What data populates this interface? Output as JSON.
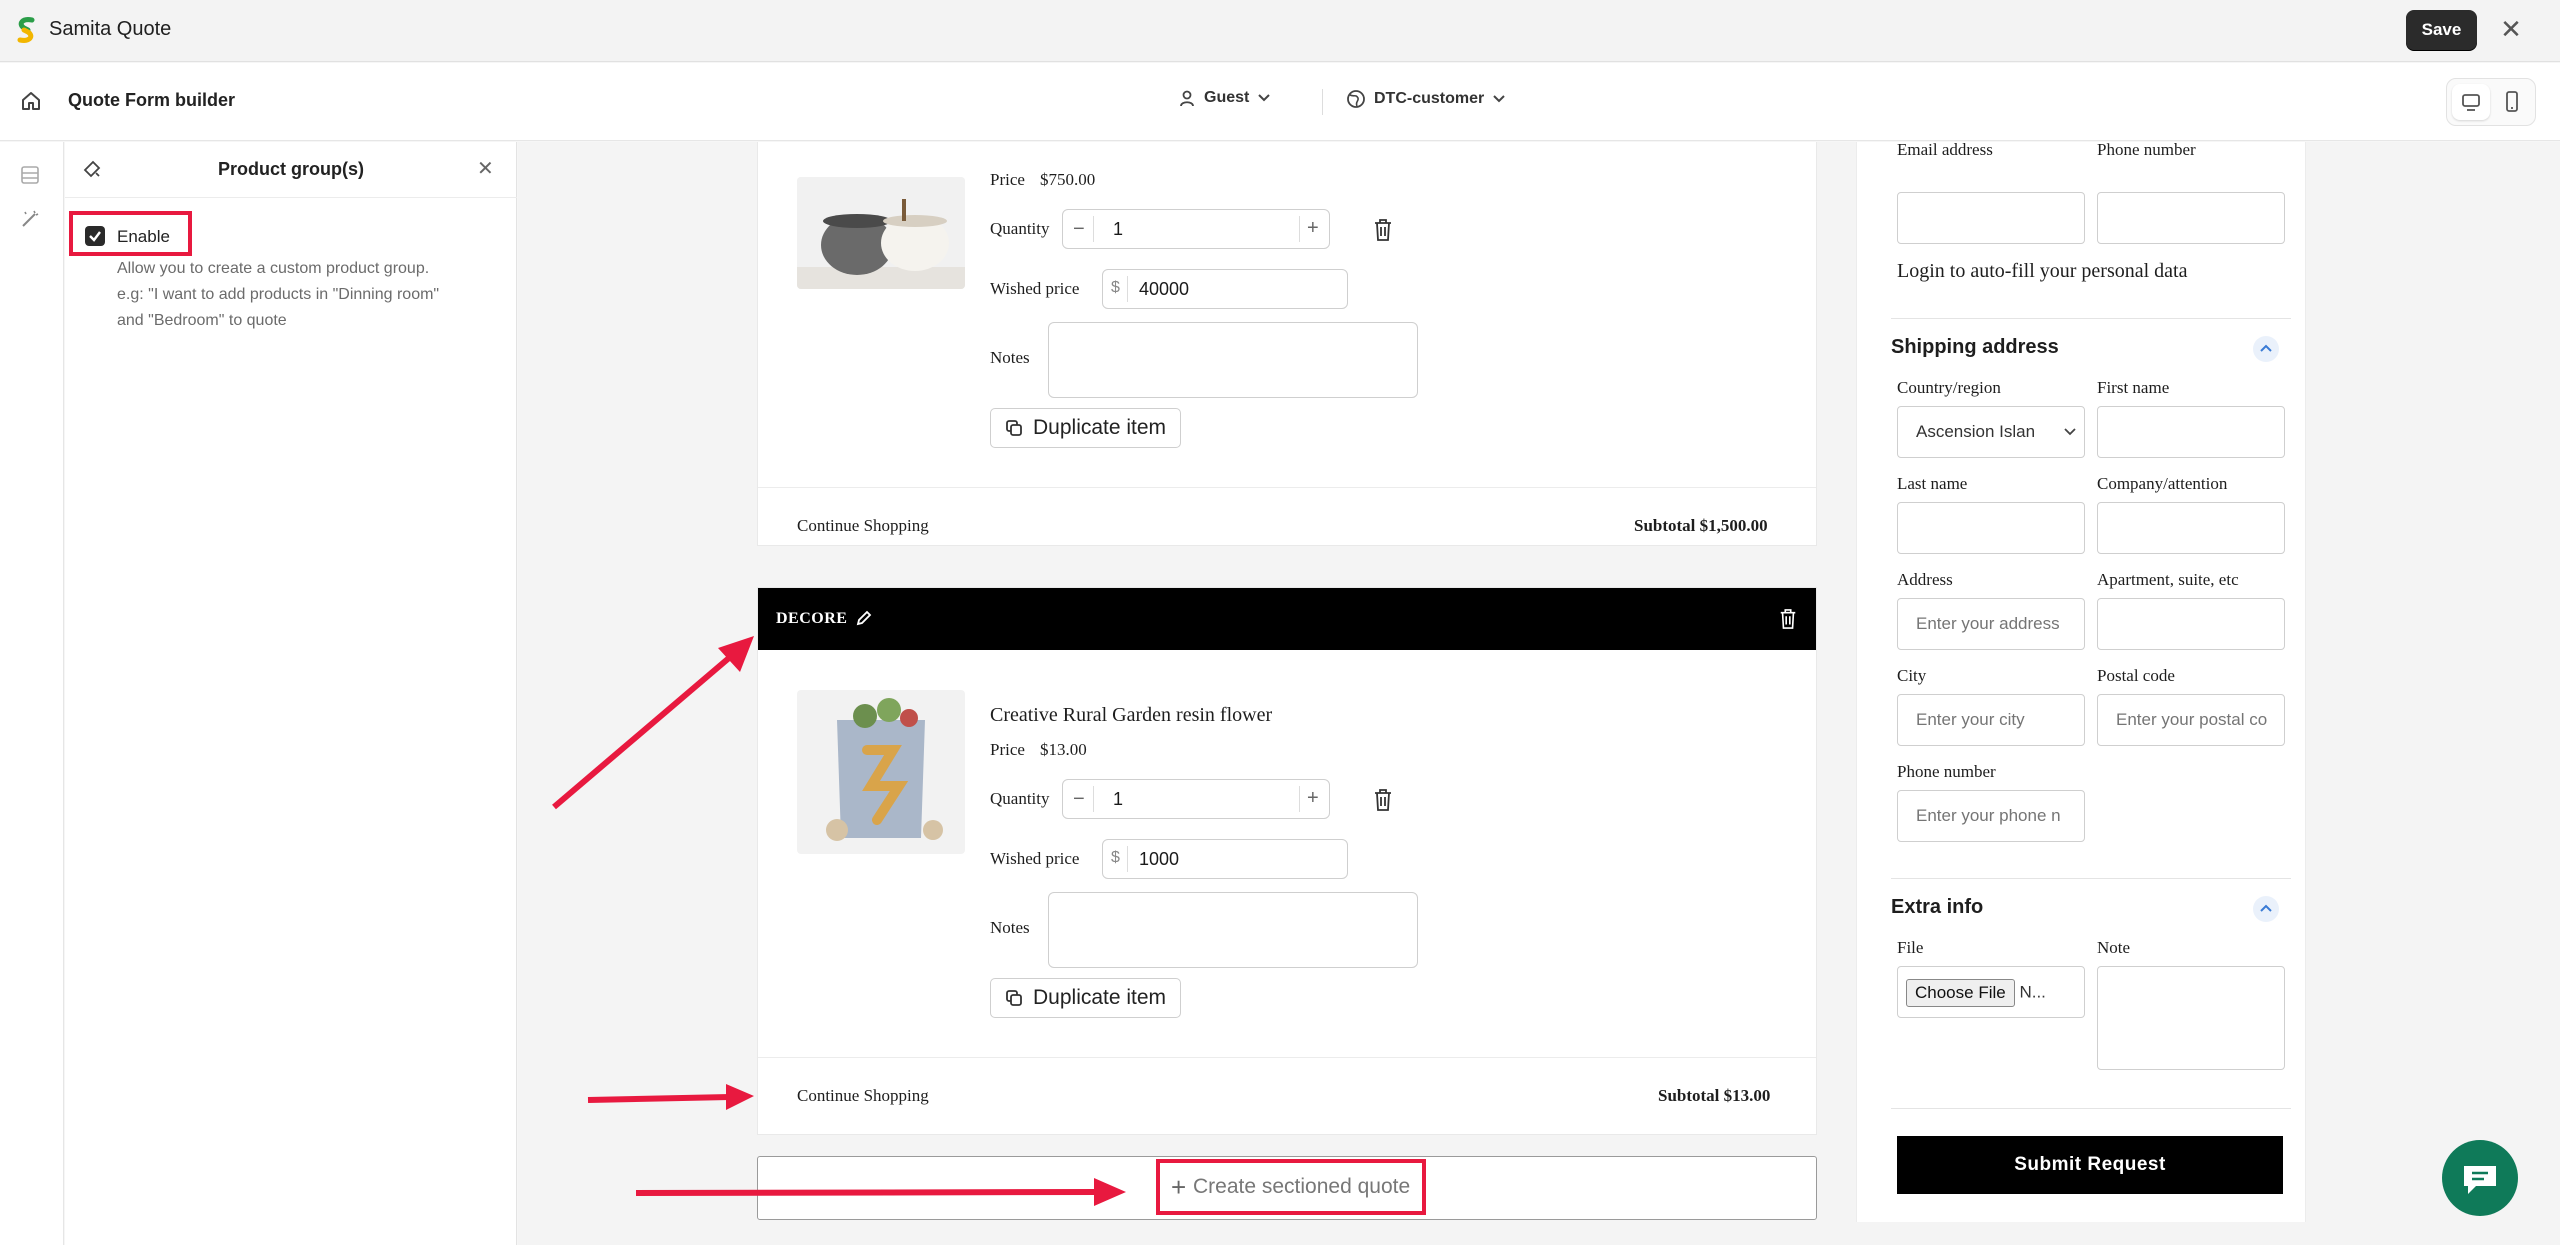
{
  "app": {
    "title": "Samita Quote",
    "save_label": "Save",
    "close_glyph": "✕"
  },
  "header": {
    "home_icon": "home-icon",
    "title": "Quote Form builder",
    "customer_type": "Guest",
    "customer_group": "DTC-customer"
  },
  "panel": {
    "title": "Product group(s)",
    "enable_label": "Enable",
    "enable_checked": true,
    "help_lines": [
      "Allow you to create a custom product group.",
      "e.g: \"I want to add products in \"Dinning room\"",
      "and \"Bedroom\" to quote"
    ]
  },
  "group1": {
    "price_label": "Price",
    "price_value": "$750.00",
    "quantity_label": "Quantity",
    "quantity_value": "1",
    "wished_label": "Wished price",
    "currency": "$",
    "wished_value": "40000",
    "notes_label": "Notes",
    "duplicate_label": "Duplicate item",
    "continue_label": "Continue Shopping",
    "subtotal": "Subtotal $1,500.00"
  },
  "group2": {
    "section_name": "DECORE",
    "product_name": "Creative Rural Garden resin flower",
    "price_label": "Price",
    "price_value": "$13.00",
    "quantity_label": "Quantity",
    "quantity_value": "1",
    "wished_label": "Wished price",
    "currency": "$",
    "wished_value": "1000",
    "notes_label": "Notes",
    "duplicate_label": "Duplicate item",
    "continue_label": "Continue Shopping",
    "subtotal": "Subtotal $13.00"
  },
  "create_section_label": "Create sectioned quote",
  "form": {
    "email_label": "Email address",
    "phone_label_top": "Phone number",
    "login_text": "Login to auto-fill your personal data",
    "shipping_title": "Shipping address",
    "country_label": "Country/region",
    "country_value": "Ascension Islan",
    "first_name_label": "First name",
    "last_name_label": "Last name",
    "company_label": "Company/attention",
    "address_label": "Address",
    "address_placeholder": "Enter your address",
    "apartment_label": "Apartment, suite, etc",
    "city_label": "City",
    "city_placeholder": "Enter your city",
    "postal_label": "Postal code",
    "postal_placeholder": "Enter your postal co",
    "phone_label": "Phone number",
    "phone_placeholder": "Enter your phone n",
    "extra_title": "Extra info",
    "file_label": "File",
    "choose_file_label": "Choose File",
    "no_file_text": "N...",
    "note_label": "Note",
    "submit_label": "Submit Request"
  },
  "colors": {
    "accent_red": "#e8193f",
    "dark": "#000000",
    "chat": "#0f7a59"
  }
}
